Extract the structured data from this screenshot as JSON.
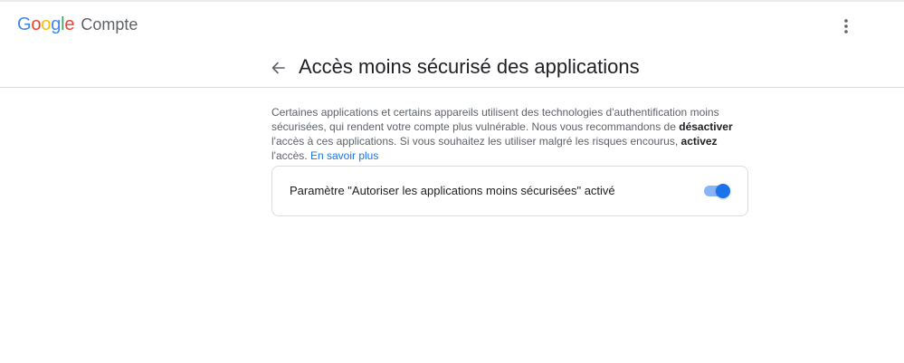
{
  "brand": {
    "logo_letters": [
      "G",
      "o",
      "o",
      "g",
      "l",
      "e"
    ],
    "logo_colors": [
      "#4285F4",
      "#EA4335",
      "#FBBC05",
      "#4285F4",
      "#34A853",
      "#EA4335"
    ],
    "product": "Compte"
  },
  "header": {
    "menu_icon": "more-vert-icon"
  },
  "page": {
    "back_icon": "arrow-back-icon",
    "title": "Accès moins sécurisé des applications"
  },
  "description": {
    "part1": "Certaines applications et certains appareils utilisent des technologies d'authentification moins sécurisées, qui rendent votre compte plus vulnérable. Nous vous recommandons de ",
    "bold1": "désactiver",
    "part2": " l'accès à ces applications. Si vous souhaitez les utiliser malgré les risques encourus, ",
    "bold2": "activez",
    "part3": " l'accès. ",
    "link": "En savoir plus"
  },
  "setting": {
    "label": "Paramètre \"Autoriser les applications moins sécurisées\" activé",
    "enabled": true,
    "track_color": "#8ab4f8",
    "thumb_color": "#1a73e8"
  },
  "colors": {
    "accent": "#1a73e8",
    "title": "#202124",
    "secondary": "#5f6368",
    "divider": "#dadce0"
  }
}
